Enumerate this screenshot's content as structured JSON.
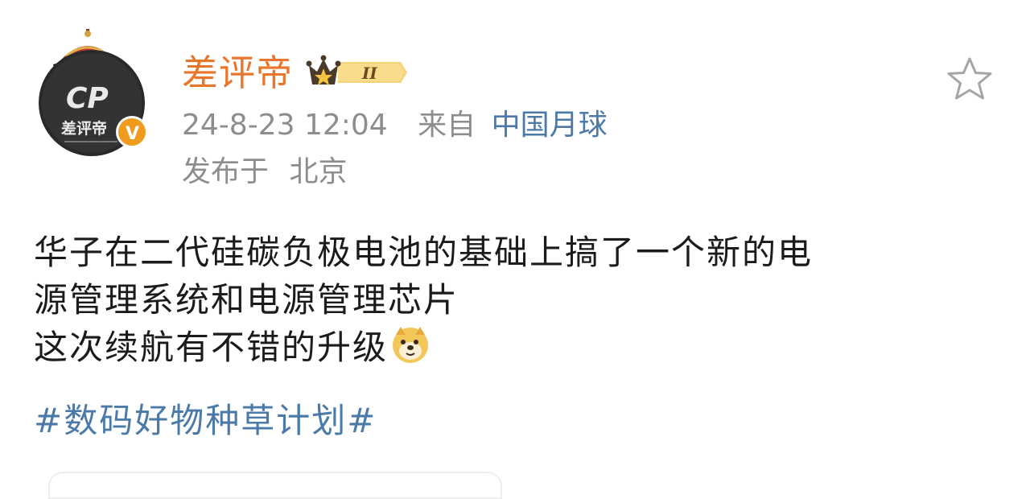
{
  "post": {
    "author": {
      "username": "差评帝",
      "avatar_text": "差评帝",
      "avatar_logo": "CP",
      "verified_icon": "v-verified-icon",
      "level_badge_label": "II"
    },
    "timestamp": "24-8-23 12:04",
    "source_prefix": "来自",
    "source_name": "中国月球",
    "location_prefix": "发布于",
    "location": "北京",
    "content_lines": [
      "华子在二代硅碳负极电池的基础上搞了一个新的电",
      "源管理系统和电源管理芯片",
      "这次续航有不错的升级"
    ],
    "emoji": "doge-emoji",
    "hashtag": "#数码好物种草计划#",
    "favorite_icon": "star-outline-icon"
  },
  "colors": {
    "username": "#e8762d",
    "link": "#4b7aa8",
    "meta": "#8d8d8d",
    "body_text": "#1b1b1b"
  }
}
